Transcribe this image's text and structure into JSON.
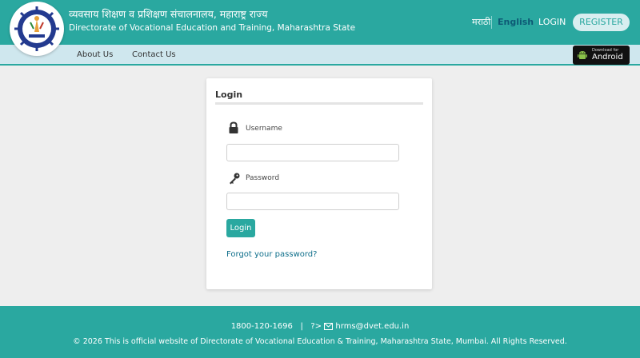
{
  "header": {
    "title_marathi": "व्यवसाय शिक्षण व प्रशिक्षण संचालनालय, महाराष्ट्र राज्य",
    "title_english": "Directorate of Vocational Education and Training, Maharashtra State",
    "lang_marathi": "मराठी",
    "lang_english": "English",
    "login_label": "LOGIN",
    "register_label": "REGISTER",
    "logo_icon": "dvet-emblem-icon"
  },
  "nav": {
    "items": [
      {
        "label": "About Us"
      },
      {
        "label": "Contact Us"
      }
    ],
    "android_badge": {
      "small": "Download for",
      "big": "Android",
      "icon": "android-icon"
    }
  },
  "login_form": {
    "title": "Login",
    "username_label": "Username",
    "username_value": "",
    "password_label": "Password",
    "password_value": "",
    "submit_label": "Login",
    "forgot_label": "Forgot your password?",
    "username_icon": "lock-icon",
    "password_icon": "key-icon"
  },
  "footer": {
    "phone": "1800-120-1696",
    "separator": "|",
    "prefix": "?>",
    "email": "hrms@dvet.edu.in",
    "copyright": "© 2026 This is official website of Directorate of Vocational Education & Training, Maharashtra State, Mumbai. All Rights Reserved."
  },
  "colors": {
    "primary": "#2aa8a0",
    "nav_bg": "#cfe7ee",
    "link": "#0d6e8a",
    "page_bg": "#eeeeee"
  }
}
